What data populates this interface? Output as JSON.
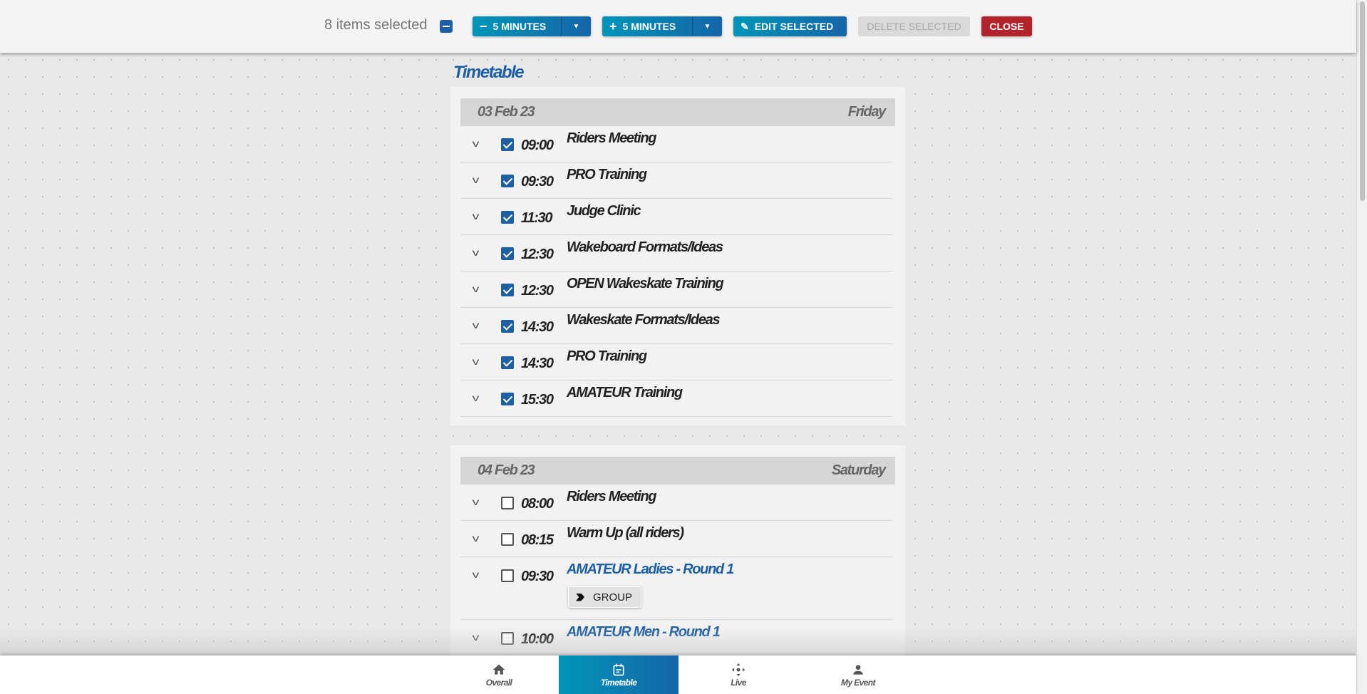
{
  "toolbar": {
    "selected_text": "8 items selected",
    "minus_label": "5 MINUTES",
    "plus_label": "5 MINUTES",
    "edit_label": "EDIT SELECTED",
    "delete_label": "DELETE SELECTED",
    "close_label": "CLOSE"
  },
  "page_title": "Timetable",
  "days": [
    {
      "date": "03 Feb 23",
      "weekday": "Friday",
      "items": [
        {
          "time": "09:00",
          "name": "Riders Meeting",
          "checked": true
        },
        {
          "time": "09:30",
          "name": "PRO Training",
          "checked": true
        },
        {
          "time": "11:30",
          "name": "Judge Clinic",
          "checked": true
        },
        {
          "time": "12:30",
          "name": "Wakeboard Formats/Ideas",
          "checked": true
        },
        {
          "time": "12:30",
          "name": "OPEN Wakeskate Training",
          "checked": true
        },
        {
          "time": "14:30",
          "name": "Wakeskate Formats/Ideas",
          "checked": true
        },
        {
          "time": "14:30",
          "name": "PRO Training",
          "checked": true
        },
        {
          "time": "15:30",
          "name": "AMATEUR Training",
          "checked": true
        }
      ]
    },
    {
      "date": "04 Feb 23",
      "weekday": "Saturday",
      "items": [
        {
          "time": "08:00",
          "name": "Riders Meeting",
          "checked": false
        },
        {
          "time": "08:15",
          "name": "Warm Up (all riders)",
          "checked": false
        },
        {
          "time": "09:30",
          "name": "AMATEUR Ladies - Round 1",
          "checked": false,
          "link": true,
          "badge": "GROUP"
        },
        {
          "time": "10:00",
          "name": "AMATEUR Men - Round 1",
          "checked": false,
          "link": true
        }
      ]
    }
  ],
  "nav": [
    {
      "label": "Overall",
      "icon": "home-icon"
    },
    {
      "label": "Timetable",
      "icon": "calendar-icon",
      "active": true
    },
    {
      "label": "Live",
      "icon": "move-icon"
    },
    {
      "label": "My Event",
      "icon": "person-icon"
    }
  ],
  "colors": {
    "accent": "#1d5fa3",
    "close": "#b3232b",
    "gradient_start": "#0096b8",
    "gradient_end": "#1565a8"
  }
}
